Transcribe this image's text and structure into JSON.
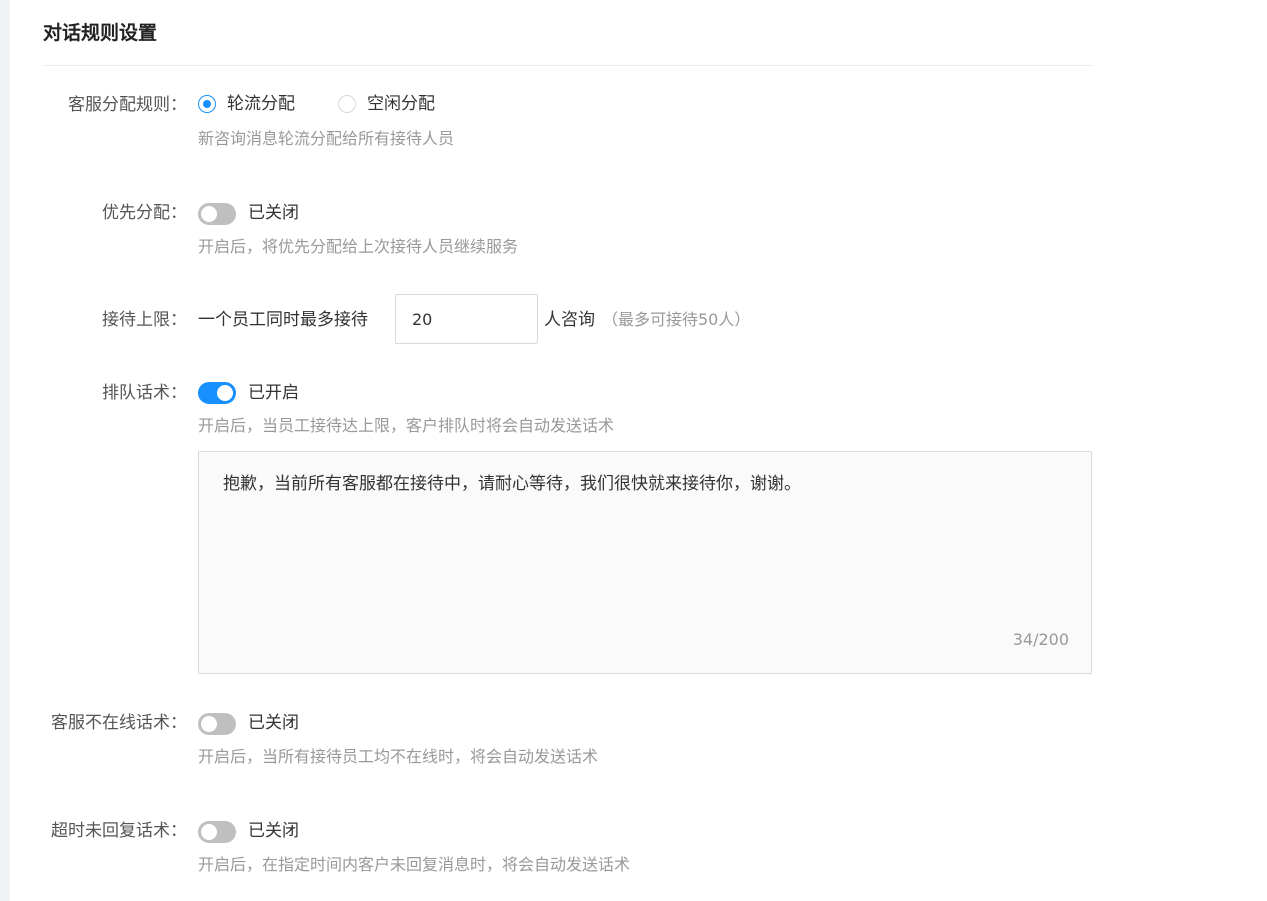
{
  "section": {
    "title": "对话规则设置"
  },
  "assign_rule": {
    "label": "客服分配规则：",
    "options": [
      {
        "label": "轮流分配",
        "checked": true
      },
      {
        "label": "空闲分配",
        "checked": false
      }
    ],
    "hint": "新咨询消息轮流分配给所有接待人员"
  },
  "priority": {
    "label": "优先分配：",
    "state": "已关闭",
    "enabled": false,
    "hint": "开启后，将优先分配给上次接待人员继续服务"
  },
  "limit": {
    "label": "接待上限：",
    "prefix": "一个员工同时最多接待",
    "value": "20",
    "suffix": "人咨询",
    "note": "（最多可接待50人）"
  },
  "queue": {
    "label": "排队话术：",
    "state": "已开启",
    "enabled": true,
    "hint": "开启后，当员工接待达上限，客户排队时将会自动发送话术",
    "message": "抱歉，当前所有客服都在接待中，请耐心等待，我们很快就来接待你，谢谢。",
    "counter": "34/200"
  },
  "offline": {
    "label": "客服不在线话术：",
    "state": "已关闭",
    "enabled": false,
    "hint": "开启后，当所有接待员工均不在线时，将会自动发送话术"
  },
  "timeout": {
    "label": "超时未回复话术：",
    "state": "已关闭",
    "enabled": false,
    "hint": "开启后，在指定时间内客户未回复消息时，将会自动发送话术"
  },
  "colors": {
    "accent": "#1890ff",
    "toggle_off": "#bfbfbf",
    "hint_text": "#999999",
    "label_text": "#555555"
  }
}
